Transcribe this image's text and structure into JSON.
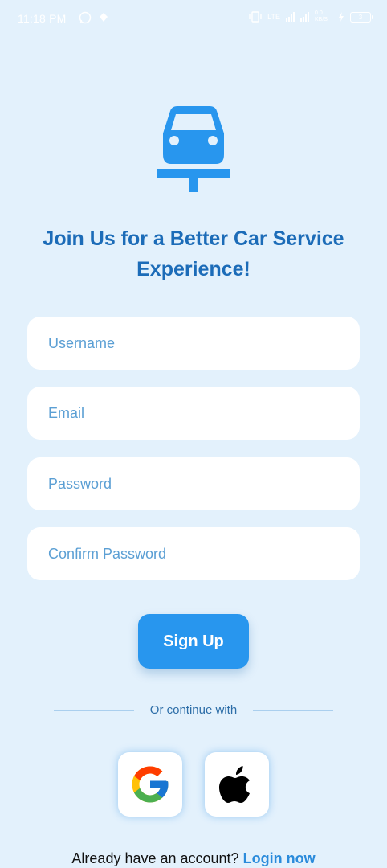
{
  "status_bar": {
    "time": "11:18 PM",
    "left_icons": [
      "whatsapp-icon",
      "notification-icon"
    ],
    "right_icons": [
      "vibrate-icon",
      "signal-icon",
      "signal-icon",
      "data-speed-icon",
      "battery-icon"
    ],
    "data_speed": "0.0 KB/S",
    "network_label": "LTE",
    "battery_level": "3"
  },
  "logo": {
    "icon": "car-lift-icon",
    "color": "#2896ee"
  },
  "headline": "Join Us for a Better Car Service Experience!",
  "form": {
    "username_placeholder": "Username",
    "email_placeholder": "Email",
    "password_placeholder": "Password",
    "confirm_password_placeholder": "Confirm Password",
    "signup_label": "Sign Up"
  },
  "divider_text": "Or continue with",
  "social": [
    {
      "name": "google",
      "icon": "google-icon"
    },
    {
      "name": "apple",
      "icon": "apple-icon"
    }
  ],
  "login_prompt": {
    "text": "Already have an account?",
    "link": "Login now"
  },
  "colors": {
    "background": "#e3f1fc",
    "accent": "#2896ee",
    "headline": "#1c6cb8"
  }
}
